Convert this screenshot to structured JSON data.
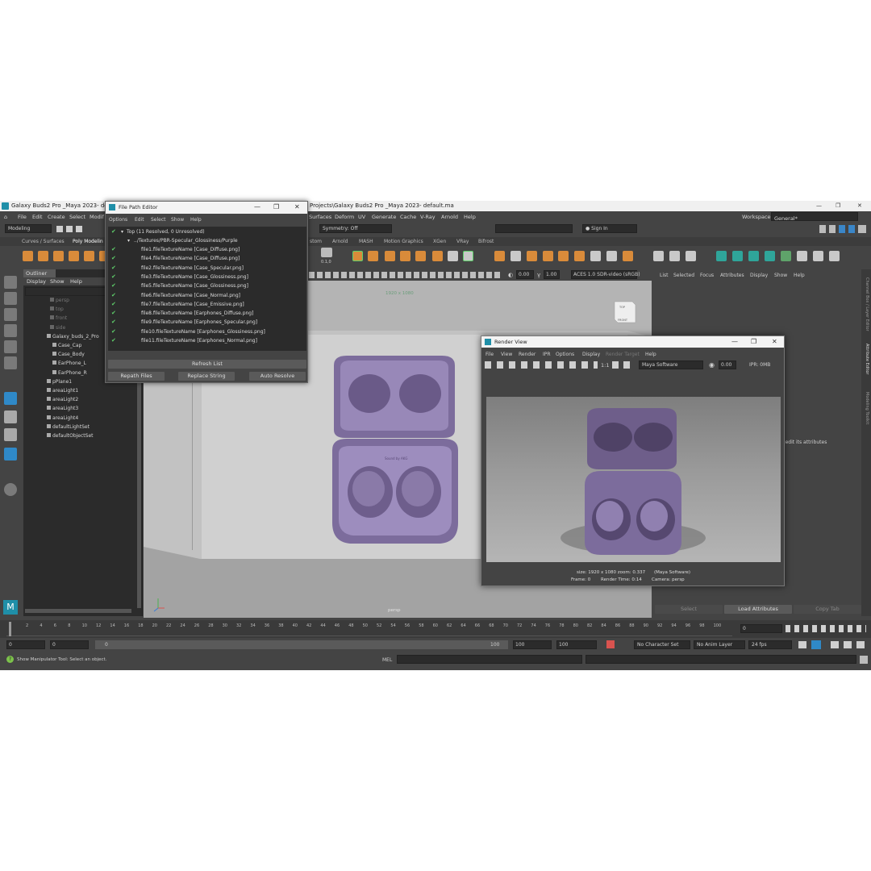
{
  "app": {
    "title_left": "Galaxy Buds2 Pro _Maya 2023- default",
    "title_right": "Projects\\Galaxy Buds2 Pro _Maya 2023- default.ma",
    "menus": [
      "File",
      "Edit",
      "Create",
      "Select",
      "Modif"
    ],
    "menus_right": [
      "Surfaces",
      "Deform",
      "UV",
      "Generate",
      "Cache",
      "V-Ray",
      "Arnold",
      "Help"
    ],
    "workspace_label": "Workspace:",
    "workspace_value": "General*",
    "mode": "Modeling",
    "symmetry": "Symmetry: Off",
    "sign_in": "Sign In",
    "shelf_tabs": [
      "Curves / Surfaces",
      "Poly Modelin",
      "stom",
      "Arnold",
      "MASH",
      "Motion Graphics",
      "XGen",
      "VRay",
      "Bifrost"
    ],
    "shelf_label": "0.1,0"
  },
  "outliner": {
    "title": "Outliner",
    "menus": [
      "Display",
      "Show",
      "Help"
    ],
    "items": [
      {
        "label": "persp",
        "dim": true
      },
      {
        "label": "top",
        "dim": true
      },
      {
        "label": "front",
        "dim": true
      },
      {
        "label": "side",
        "dim": true
      },
      {
        "label": "Galaxy_buds_2_Pro",
        "dim": false
      },
      {
        "label": "Case_Cap",
        "dim": false
      },
      {
        "label": "Case_Body",
        "dim": false
      },
      {
        "label": "EarPhone_L",
        "dim": false
      },
      {
        "label": "EarPhone_R",
        "dim": false
      },
      {
        "label": "pPlane1",
        "dim": false
      },
      {
        "label": "areaLight1",
        "dim": false
      },
      {
        "label": "areaLight2",
        "dim": false
      },
      {
        "label": "areaLight3",
        "dim": false
      },
      {
        "label": "areaLight4",
        "dim": false
      },
      {
        "label": "defaultLightSet",
        "dim": false
      },
      {
        "label": "defaultObjectSet",
        "dim": false
      }
    ]
  },
  "viewport": {
    "exposure": "0.00",
    "gamma": "1.00",
    "colorspace": "ACES 1.0 SDR-video (sRGB)",
    "resolution": "1920 x 1080",
    "camera": "persp",
    "cube_top": "TOP",
    "cube_front": "FRONT",
    "brand_text": "Sound by AKG"
  },
  "attribute_editor": {
    "menus": [
      "List",
      "Selected",
      "Focus",
      "Attributes",
      "Display",
      "Show",
      "Help"
    ],
    "hint": "l edit its attributes",
    "buttons": [
      "Select",
      "Load Attributes",
      "Copy Tab"
    ],
    "side_tabs": [
      "Channel Box / Layer Editor",
      "Attribute Editor",
      "Modeling Toolkit"
    ]
  },
  "file_path_editor": {
    "title": "File Path Editor",
    "menus": [
      "Options",
      "Edit",
      "Select",
      "Show",
      "Help"
    ],
    "root": "Top (11 Resolved, 0 Unresolved)",
    "folder": "../Textures/PBR-Specular_Glossiness/Purple",
    "files": [
      "file1.fileTextureName [Case_Diffuse.png]",
      "file4.fileTextureName [Case_Diffuse.png]",
      "file2.fileTextureName [Case_Specular.png]",
      "file3.fileTextureName [Case_Glossiness.png]",
      "file5.fileTextureName [Case_Glossiness.png]",
      "file6.fileTextureName [Case_Normal.png]",
      "file7.fileTextureName [Case_Emissive.png]",
      "file8.fileTextureName [Earphones_Diffuse.png]",
      "file9.fileTextureName [Earphones_Specular.png]",
      "file10.fileTextureName [Earphones_Glossiness.png]",
      "file11.fileTextureName [Earphones_Normal.png]"
    ],
    "refresh": "Refresh List",
    "repath": "Repath Files",
    "replace": "Replace String",
    "auto": "Auto Resolve"
  },
  "render_view": {
    "title": "Render View",
    "menus": [
      "File",
      "View",
      "Render",
      "IPR",
      "Options",
      "Display",
      "Render Target",
      "Help"
    ],
    "ratio": "1:1",
    "renderer": "Maya Software",
    "value": "0.00",
    "ipr": "IPR: 0MB",
    "info1": "size: 1920 x 1080 zoom: 0.337",
    "info1b": "(Maya Software)",
    "info2a": "Frame: 0",
    "info2b": "Render Time: 0:14",
    "info2c": "Camera: persp"
  },
  "timeline": {
    "ticks": [
      "2",
      "4",
      "6",
      "8",
      "10",
      "12",
      "14",
      "16",
      "18",
      "20",
      "22",
      "24",
      "26",
      "28",
      "30",
      "32",
      "34",
      "36",
      "38",
      "40",
      "42",
      "44",
      "46",
      "48",
      "50",
      "52",
      "54",
      "56",
      "58",
      "60",
      "62",
      "64",
      "66",
      "68",
      "70",
      "72",
      "74",
      "76",
      "78",
      "80",
      "82",
      "84",
      "86",
      "88",
      "90",
      "92",
      "94",
      "96",
      "98",
      "100"
    ],
    "current": "0",
    "start": "0",
    "start2": "0",
    "slider_left": "0",
    "slider_right": "100",
    "end": "100",
    "end2": "100",
    "character_set": "No Character Set",
    "anim_layer": "No Anim Layer",
    "fps": "24 fps"
  },
  "status": {
    "help_line": "Show Manipulator Tool: Select an object.",
    "mel": "MEL"
  },
  "colors": {
    "accent": "#5fd06b",
    "purple": "#8a7aa8",
    "highlight": "#2f89c8"
  }
}
